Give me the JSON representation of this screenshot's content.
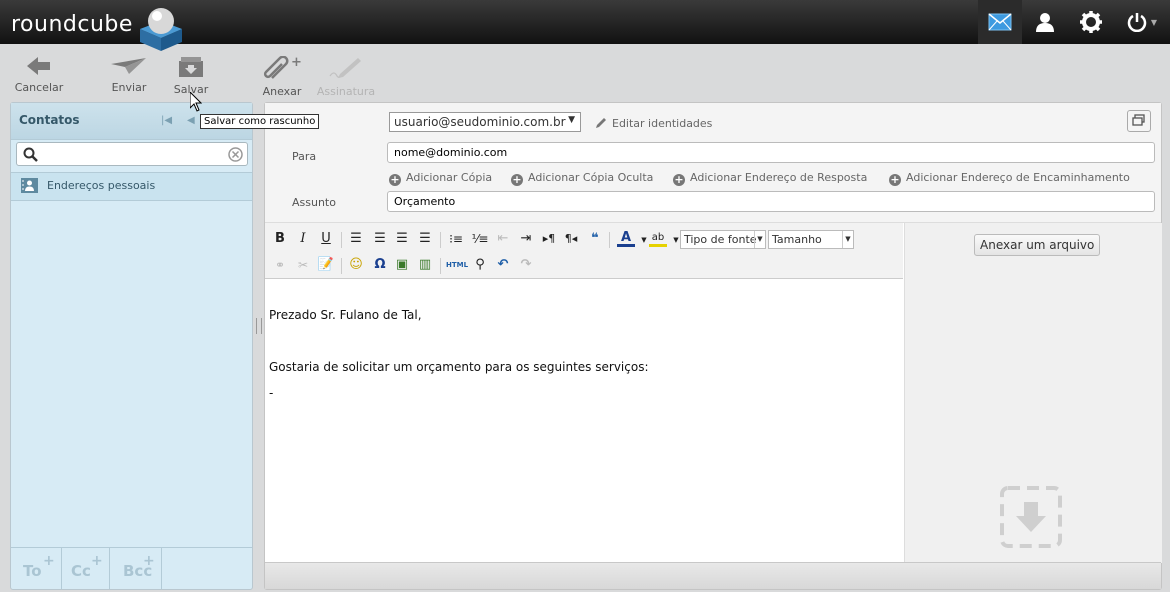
{
  "app": {
    "logo_text": "roundcube",
    "colors": {
      "accent": "#3d8ec8",
      "panel": "#d7ebf5",
      "topbar": "#1a1a1a"
    }
  },
  "topnav": {
    "items": [
      {
        "name": "mail-icon",
        "active": true
      },
      {
        "name": "contacts-icon"
      },
      {
        "name": "settings-icon"
      },
      {
        "name": "logout-icon"
      }
    ]
  },
  "toolbar": {
    "cancel_label": "Cancelar",
    "send_label": "Enviar",
    "save_label": "Salvar",
    "attach_label": "Anexar",
    "signature_label": "Assinatura"
  },
  "tooltip": {
    "text": "Salvar como rascunho"
  },
  "contacts": {
    "title": "Contatos",
    "search_placeholder": "",
    "items": [
      {
        "label": "Endereços pessoais"
      }
    ],
    "footer": {
      "to": "To",
      "cc": "Cc",
      "bcc": "Bcc"
    }
  },
  "compose": {
    "from_value": "usuario@seudominio.com.br",
    "edit_identities": "Editar identidades",
    "to_label": "Para",
    "to_value": "nome@dominio.com",
    "add_links": [
      "Adicionar Cópia",
      "Adicionar Cópia Oculta",
      "Adicionar Endereço de Resposta",
      "Adicionar Endereço de Encaminhamento"
    ],
    "subject_label": "Assunto",
    "subject_value": "Orçamento",
    "font_select": "Tipo de fonte",
    "size_select": "Tamanho",
    "html_label": "HTML",
    "body_lines": [
      "Prezado Sr. Fulano de Tal,",
      "Gostaria de solicitar um orçamento para os seguintes serviços:",
      "-"
    ],
    "attach_button": "Anexar um arquivo"
  }
}
